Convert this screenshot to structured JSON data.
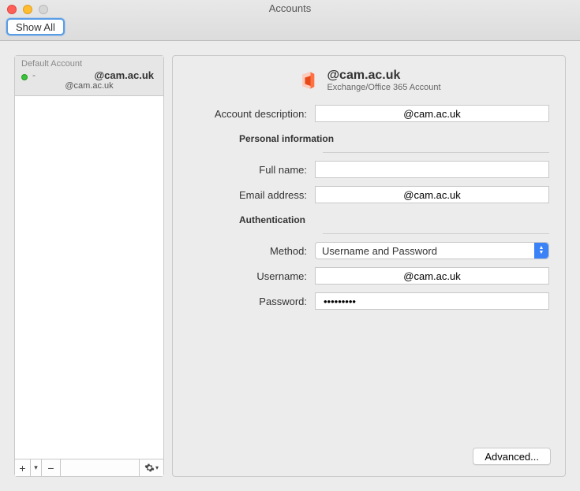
{
  "window": {
    "title": "Accounts",
    "show_all": "Show All"
  },
  "sidebar": {
    "default_label": "Default Account",
    "account_name": "@cam.ac.uk",
    "account_email": "@cam.ac.uk"
  },
  "main": {
    "header_title": "@cam.ac.uk",
    "header_subtitle": "Exchange/Office 365 Account",
    "labels": {
      "account_description": "Account description:",
      "personal_info": "Personal information",
      "full_name": "Full name:",
      "email_address": "Email address:",
      "authentication": "Authentication",
      "method": "Method:",
      "username": "Username:",
      "password": "Password:"
    },
    "values": {
      "account_description": "@cam.ac.uk",
      "full_name": "",
      "email_address": "@cam.ac.uk",
      "method": "Username and Password",
      "username": "@cam.ac.uk",
      "password": "•••••••••"
    },
    "advanced": "Advanced..."
  }
}
